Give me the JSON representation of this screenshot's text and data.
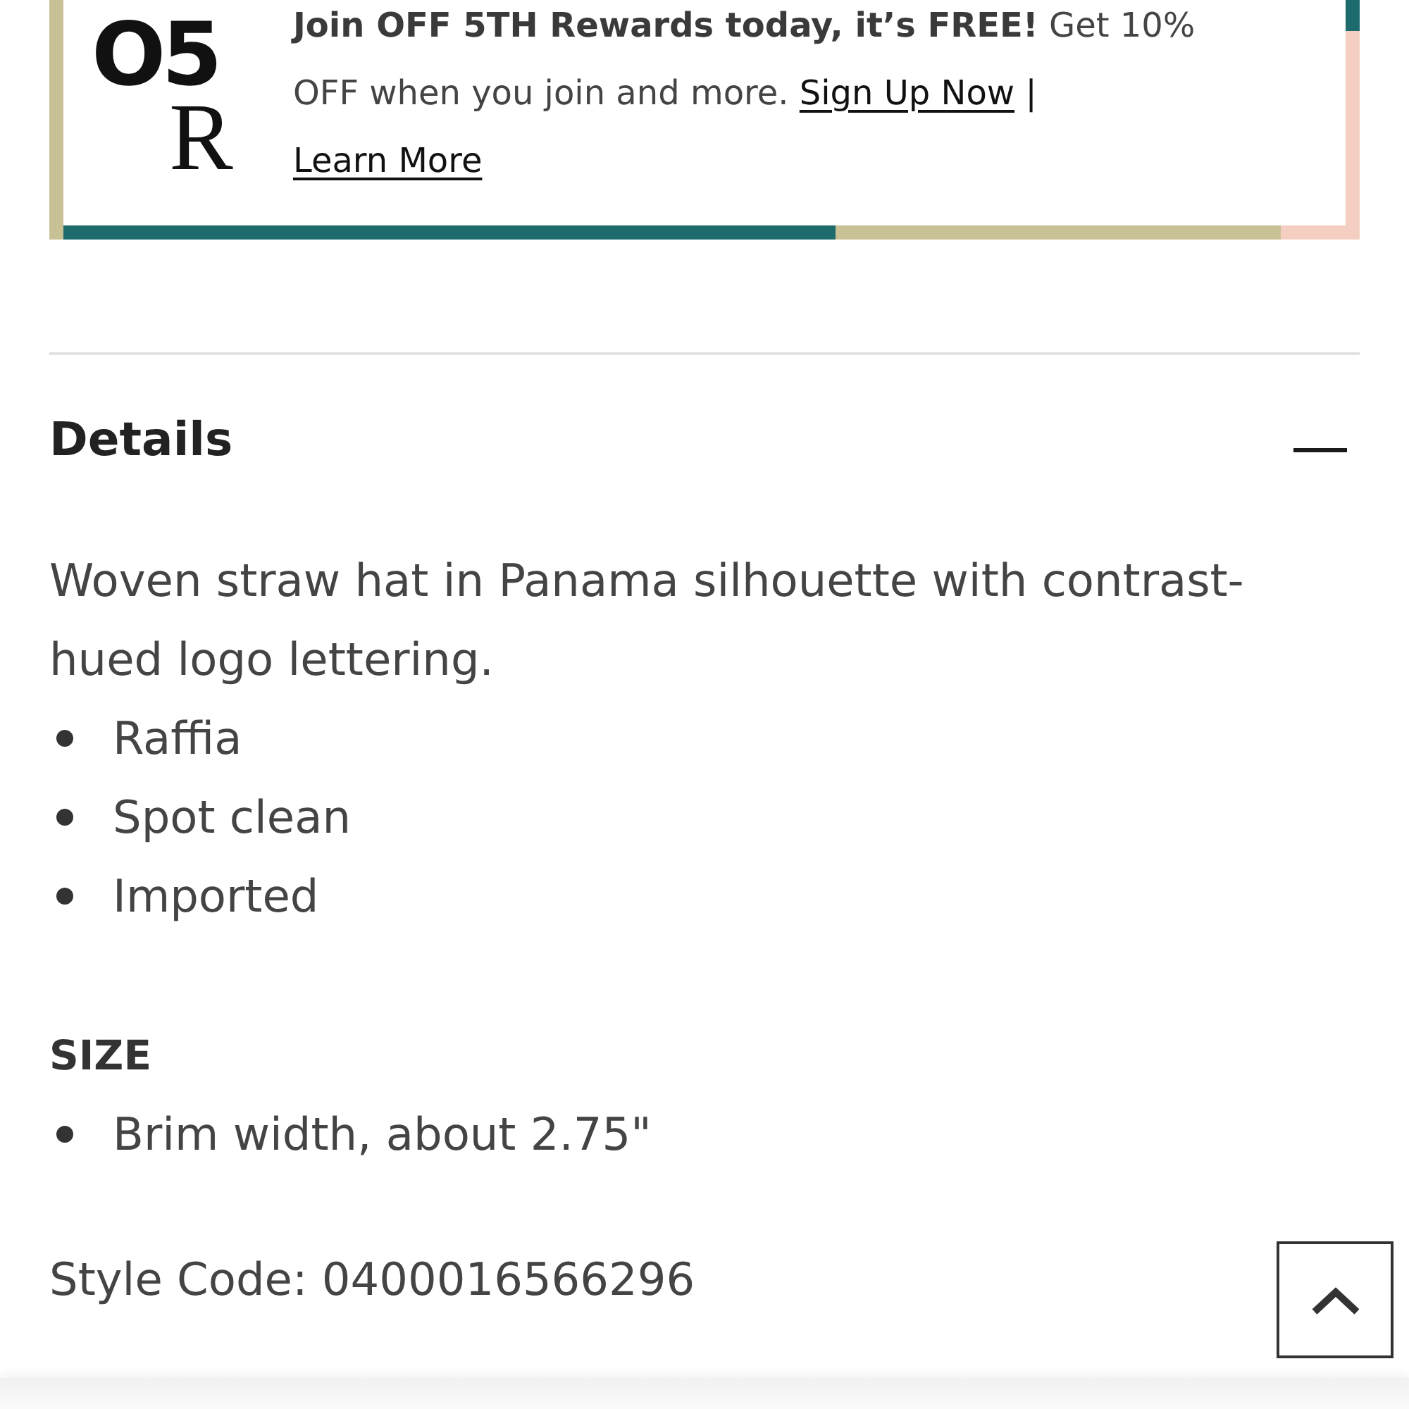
{
  "promo": {
    "logo": [
      "O5",
      "R"
    ],
    "text": "**Join OFF 5TH Rewards today, it’s FREE!** Get 10% OFF when you join and more.",
    "links": [
      "Sign Up Now",
      "Learn More"
    ],
    "separator": "|"
  },
  "details": {
    "title": "Details",
    "expanded": true,
    "description": "Woven straw hat in Panama silhouette with contrast-hued logo lettering.",
    "features": [
      "Raffia",
      "Spot clean",
      "Imported"
    ],
    "size_heading": "SIZE",
    "size_items": [
      "Brim width, about 2.75\""
    ],
    "style_code": "Style Code: 0400016566296"
  }
}
